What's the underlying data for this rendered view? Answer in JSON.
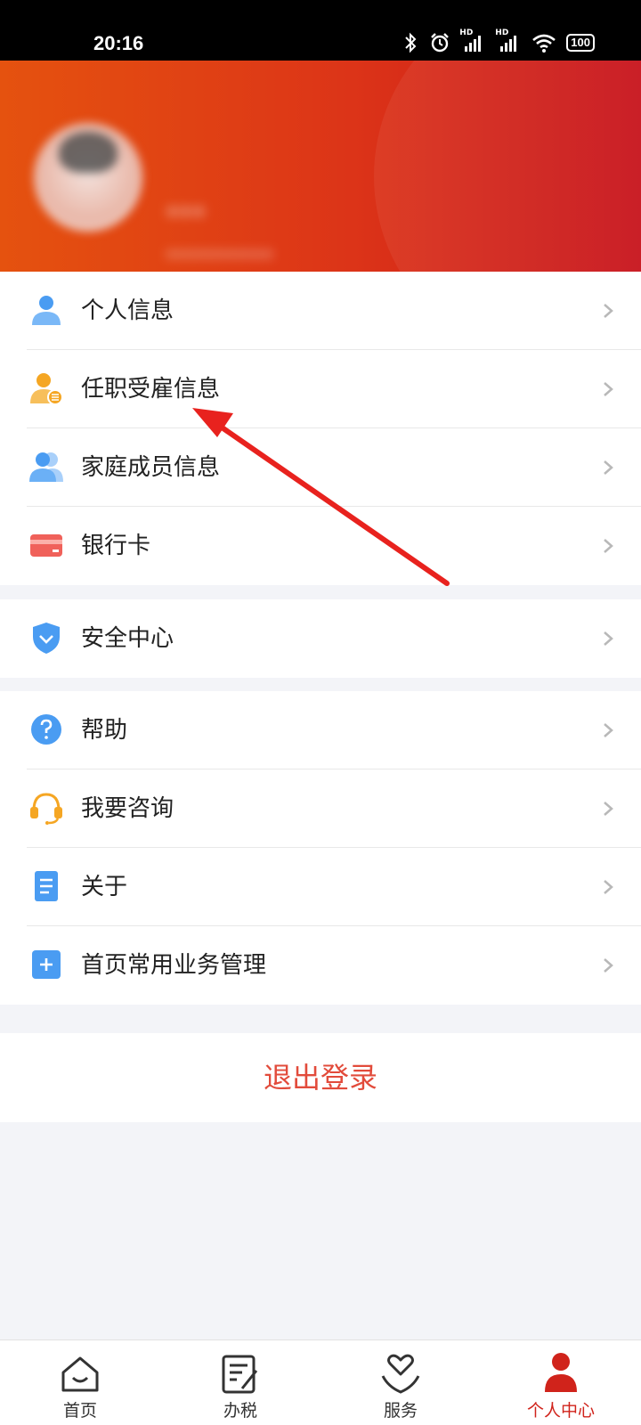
{
  "status_bar": {
    "time": "20:16",
    "network_1": "HD",
    "network_2": "HD",
    "battery": "100"
  },
  "profile": {
    "name_blurred": "***",
    "phone_blurred": "***********"
  },
  "menu_group_1": [
    {
      "label": "个人信息",
      "icon": "person-icon",
      "color": "#4a9cf2"
    },
    {
      "label": "任职受雇信息",
      "icon": "employment-icon",
      "color": "#f5a623"
    },
    {
      "label": "家庭成员信息",
      "icon": "family-icon",
      "color": "#4a9cf2"
    },
    {
      "label": "银行卡",
      "icon": "bank-card-icon",
      "color": "#f0615a"
    }
  ],
  "menu_group_2": [
    {
      "label": "安全中心",
      "icon": "shield-icon",
      "color": "#4a9cf2"
    }
  ],
  "menu_group_3": [
    {
      "label": "帮助",
      "icon": "help-icon",
      "color": "#4a9cf2"
    },
    {
      "label": "我要咨询",
      "icon": "headset-icon",
      "color": "#f5a623"
    },
    {
      "label": "关于",
      "icon": "document-icon",
      "color": "#4a9cf2"
    },
    {
      "label": "首页常用业务管理",
      "icon": "plus-square-icon",
      "color": "#4a9cf2"
    }
  ],
  "logout_label": "退出登录",
  "tabs": [
    {
      "label": "首页",
      "icon": "home-icon"
    },
    {
      "label": "办税",
      "icon": "tax-icon"
    },
    {
      "label": "服务",
      "icon": "service-icon"
    },
    {
      "label": "个人中心",
      "icon": "profile-icon",
      "active": true
    }
  ],
  "colors": {
    "header_start": "#e5520f",
    "header_end": "#c7121a",
    "accent": "#d0231b",
    "logout": "#e24b3b",
    "annotation_arrow": "#e8221e"
  }
}
